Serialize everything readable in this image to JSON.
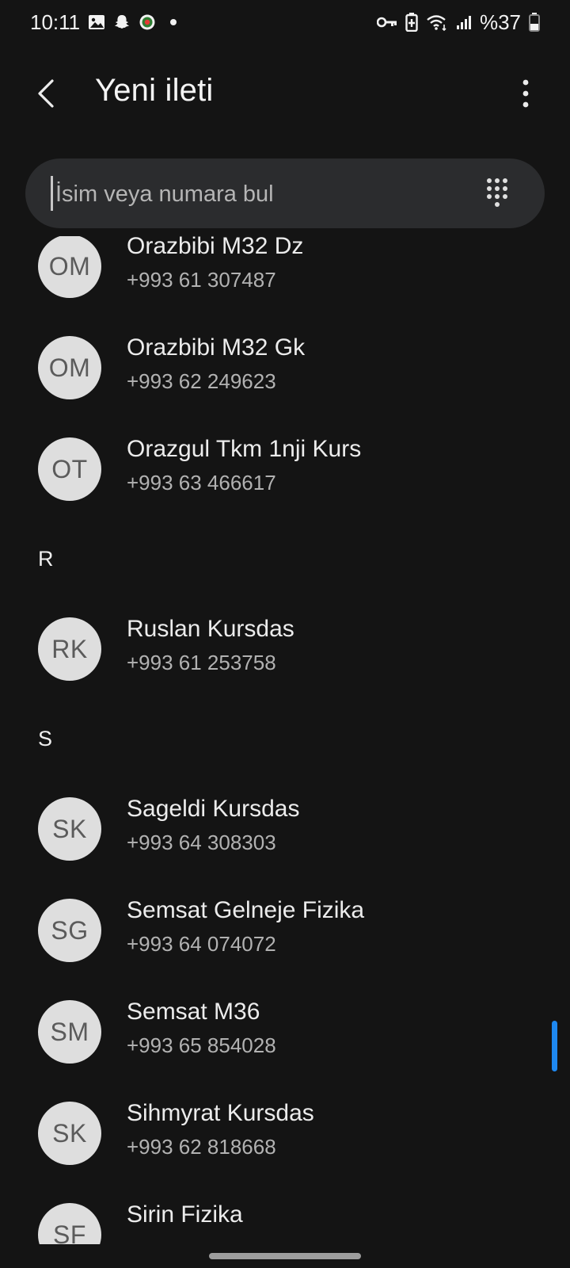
{
  "status_bar": {
    "time": "10:11",
    "battery": "%37",
    "left_icons": [
      "gallery-icon",
      "snapchat-icon",
      "app-badge-icon",
      "notification-dot"
    ],
    "right_icons": [
      "vpn-key-icon",
      "battery-saver-icon",
      "wifi-icon",
      "signal-icon",
      "battery-icon"
    ]
  },
  "app_bar": {
    "title": "Yeni ileti"
  },
  "search": {
    "placeholder": "İsim veya numara bul"
  },
  "list": [
    {
      "kind": "contact",
      "initials": "OM",
      "name": "Orazbibi M32 Dz",
      "phone": "+993 61 307487"
    },
    {
      "kind": "contact",
      "initials": "OM",
      "name": "Orazbibi M32 Gk",
      "phone": "+993 62 249623"
    },
    {
      "kind": "contact",
      "initials": "OT",
      "name": "Orazgul Tkm 1nji Kurs",
      "phone": "+993 63 466617"
    },
    {
      "kind": "section",
      "label": "R"
    },
    {
      "kind": "contact",
      "initials": "RK",
      "name": "Ruslan Kursdas",
      "phone": "+993 61 253758"
    },
    {
      "kind": "section",
      "label": "S"
    },
    {
      "kind": "contact",
      "initials": "SK",
      "name": "Sageldi Kursdas",
      "phone": "+993 64 308303"
    },
    {
      "kind": "contact",
      "initials": "SG",
      "name": "Semsat Gelneje Fizika",
      "phone": "+993 64 074072"
    },
    {
      "kind": "contact",
      "initials": "SM",
      "name": "Semsat M36",
      "phone": "+993 65 854028"
    },
    {
      "kind": "contact",
      "initials": "SK",
      "name": "Sihmyrat Kursdas",
      "phone": "+993 62 818668"
    },
    {
      "kind": "contact",
      "initials": "SF",
      "name": "Sirin Fizika",
      "phone": ""
    }
  ],
  "colors": {
    "background": "#141414",
    "search_bg": "#2b2c2e",
    "avatar_bg": "#dedede",
    "scroll_accent": "#1e88f0"
  }
}
